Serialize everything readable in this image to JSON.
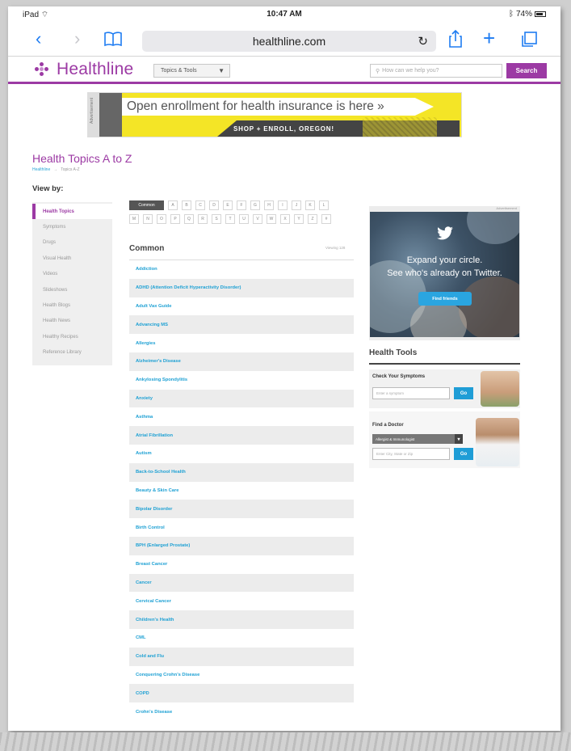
{
  "status_bar": {
    "device": "iPad",
    "time": "10:47 AM",
    "battery": "74%"
  },
  "browser": {
    "url": "healthline.com",
    "icons": [
      "back-icon",
      "forward-icon",
      "bookmarks-icon",
      "reload-icon",
      "share-icon",
      "new-tab-icon",
      "tabs-icon"
    ]
  },
  "site": {
    "logo": "Healthline",
    "topics_dropdown": "Topics & Tools",
    "search_placeholder": "How can we help you?",
    "search_button": "Search",
    "brand_color": "#9c3aa4"
  },
  "banner_ad": {
    "label": "Advertisement",
    "headline": "Open enrollment for health insurance is here »",
    "subline": "SHOP + ENROLL, OREGON!"
  },
  "page": {
    "title": "Health Topics A to Z",
    "breadcrumb": [
      "Healthline",
      "Topics A-Z"
    ],
    "view_by": "View by:"
  },
  "sidebar": {
    "items": [
      {
        "label": "Health Topics",
        "active": true
      },
      {
        "label": "Symptoms"
      },
      {
        "label": "Drugs"
      },
      {
        "label": "Visual Health"
      },
      {
        "label": "Videos"
      },
      {
        "label": "Slideshows"
      },
      {
        "label": "Health Blogs"
      },
      {
        "label": "Health News"
      },
      {
        "label": "Healthy Recipes"
      },
      {
        "label": "Reference Library"
      }
    ]
  },
  "letters": {
    "row1": [
      "Common",
      "A",
      "B",
      "C",
      "D",
      "E",
      "F",
      "G",
      "H",
      "I",
      "J",
      "K",
      "L"
    ],
    "row2": [
      "M",
      "N",
      "O",
      "P",
      "Q",
      "R",
      "S",
      "T",
      "U",
      "V",
      "W",
      "X",
      "Y",
      "Z",
      "#"
    ]
  },
  "list": {
    "title": "Common",
    "count": "Viewing 128",
    "topics": [
      "Addiction",
      "ADHD (Attention Deficit Hyperactivity Disorder)",
      "Adult Vax Guide",
      "Advancing MS",
      "Allergies",
      "Alzheimer's Disease",
      "Ankylosing Spondylitis",
      "Anxiety",
      "Asthma",
      "Atrial Fibrillation",
      "Autism",
      "Back-to-School Health",
      "Beauty & Skin Care",
      "Bipolar Disorder",
      "Birth Control",
      "BPH (Enlarged Prostate)",
      "Breast Cancer",
      "Cancer",
      "Cervical Cancer",
      "Children's Health",
      "CML",
      "Cold and Flu",
      "Conquering Crohn's Disease",
      "COPD",
      "Crohn's Disease"
    ]
  },
  "twitter_ad": {
    "label": "Advertisement",
    "line1": "Expand your circle.",
    "line2": "See who's already on Twitter.",
    "button": "Find friends"
  },
  "health_tools": {
    "title": "Health Tools",
    "symptom_checker": {
      "title": "Check Your Symptoms",
      "placeholder": "Enter a symptom",
      "button": "Go"
    },
    "find_doctor": {
      "title": "Find a Doctor",
      "specialty": "Allergist & Immunologist",
      "placeholder": "Enter City, State or Zip",
      "button": "Go"
    }
  }
}
